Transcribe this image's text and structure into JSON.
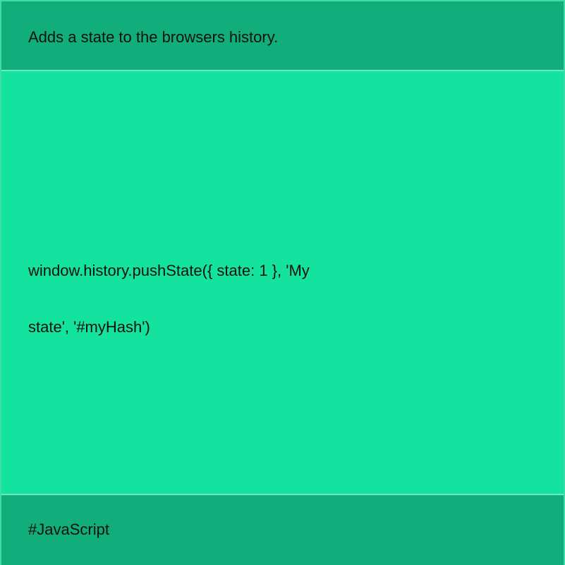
{
  "header": {
    "description": "Adds a state to the browsers history."
  },
  "main": {
    "code_line_1": "window.history.pushState({ state: 1 }, 'My",
    "code_line_2": "state', '#myHash')"
  },
  "footer": {
    "tag": "#JavaScript"
  },
  "colors": {
    "header_bg": "#11ad7a",
    "body_bg": "#13e39e",
    "border": "#3fdca8",
    "text": "#111111"
  }
}
